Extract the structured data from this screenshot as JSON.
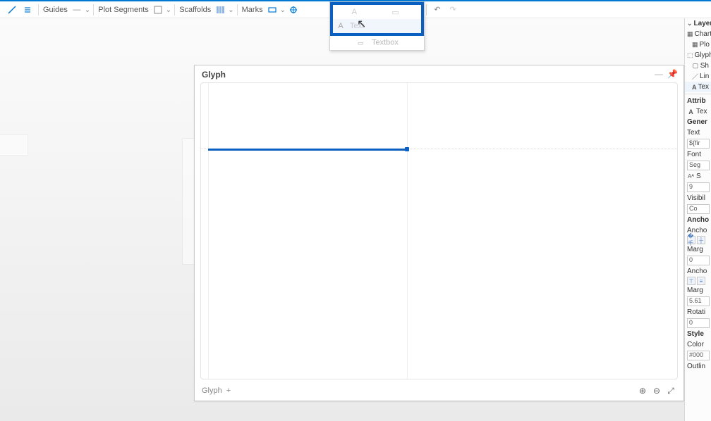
{
  "toolbar": {
    "guides_label": "Guides",
    "plotseg_label": "Plot Segments",
    "scaffolds_label": "Scaffolds",
    "marks_label": "Marks"
  },
  "dropdown": {
    "text_label": "Text",
    "textbox_label": "Textbox"
  },
  "glyph": {
    "title": "Glyph",
    "footer_label": "Glyph"
  },
  "layers": {
    "title": "Layers",
    "chart": "Chart",
    "plotseg": "Plo",
    "glyph": "Glyph",
    "shape": "Sh",
    "link": "Lin",
    "text": "Tex"
  },
  "attributes": {
    "title": "Attrib",
    "text_sel": "Tex",
    "general": "Gener",
    "text_label": "Text",
    "text_value": "${fir",
    "font_label": "Font",
    "font_value": "Seg",
    "size_glyph": "S",
    "size_value": "9",
    "visibility": "Visibil",
    "visibility_value": "Co",
    "anchor_section": "Ancho",
    "anchor_label": "Ancho",
    "margin_label": "Marg",
    "margin_top": "0",
    "anchor_label2": "Ancho",
    "margin_label2": "Marg",
    "margin_val2": "5.61",
    "rotation": "Rotati",
    "rotation_val": "0",
    "style_section": "Style",
    "color_label": "Color",
    "color_value": "#000",
    "outline": "Outlin"
  }
}
